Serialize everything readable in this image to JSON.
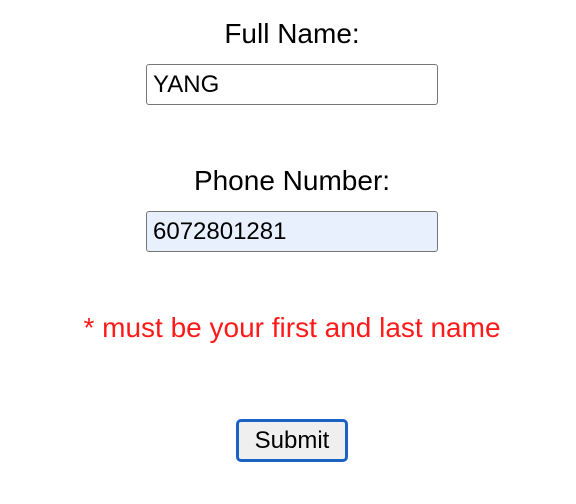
{
  "form": {
    "name_label": "Full Name:",
    "name_value": "YANG",
    "phone_label": "Phone Number:",
    "phone_value": "6072801281",
    "error_message": "* must be your first and last name",
    "submit_label": "Submit"
  },
  "colors": {
    "error_text": "#ff1a1a",
    "autofill_background": "#e8f0fe",
    "focus_ring": "#1a62c4"
  }
}
